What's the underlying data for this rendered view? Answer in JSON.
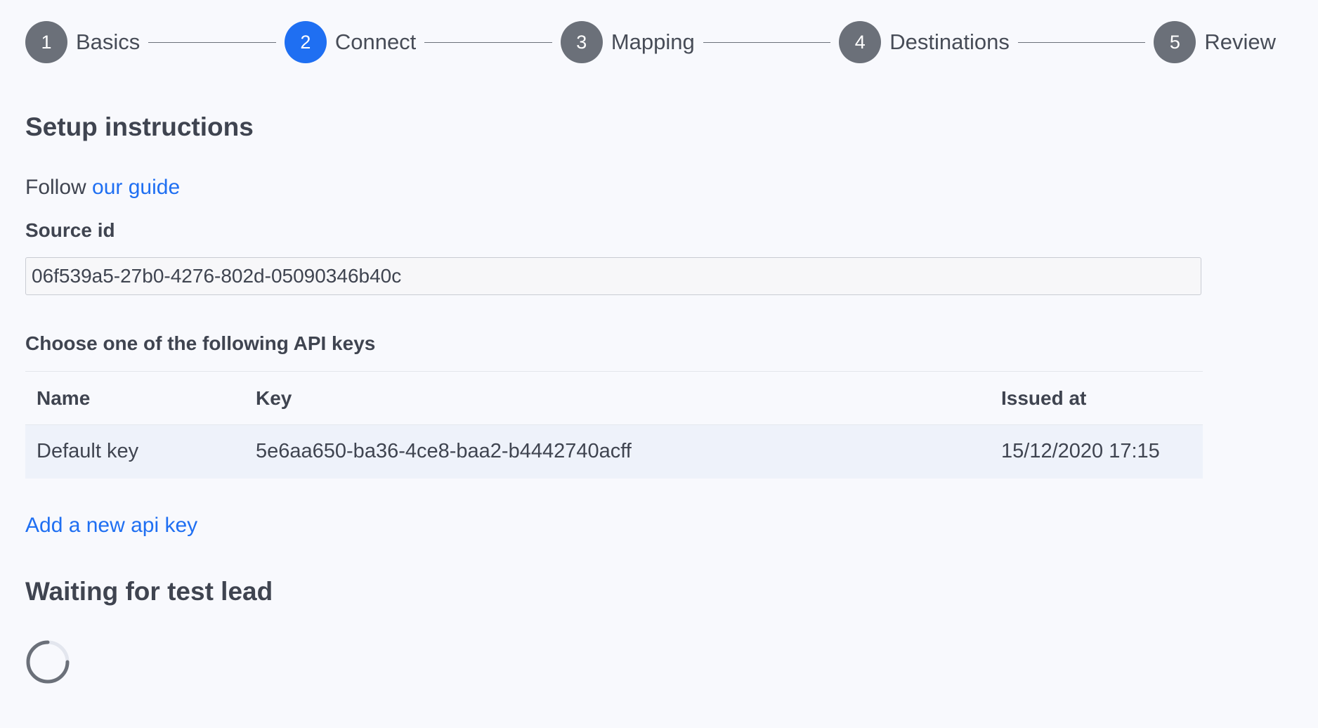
{
  "stepper": {
    "steps": [
      {
        "number": "1",
        "label": "Basics"
      },
      {
        "number": "2",
        "label": "Connect"
      },
      {
        "number": "3",
        "label": "Mapping"
      },
      {
        "number": "4",
        "label": "Destinations"
      },
      {
        "number": "5",
        "label": "Review"
      }
    ],
    "active_step": "2",
    "colors": {
      "active": "#1f6ff2",
      "inactive": "#6b7079"
    }
  },
  "setup": {
    "title": "Setup instructions",
    "follow_prefix": "Follow",
    "guide_link": "our guide",
    "source_id_label": "Source id",
    "source_id_value": "06f539a5-27b0-4276-802d-05090346b40c"
  },
  "api_keys": {
    "heading": "Choose one of the following API keys",
    "columns": {
      "name": "Name",
      "key": "Key",
      "issued": "Issued at"
    },
    "rows": [
      {
        "name": "Default key",
        "key": "5e6aa650-ba36-4ce8-baa2-b4442740acff",
        "issued": "15/12/2020 17:15"
      }
    ],
    "add_link": "Add a new api key"
  },
  "waiting": {
    "title": "Waiting for test lead",
    "spinner_icon": "loading-spinner-icon"
  },
  "theme": {
    "link_color": "#1f6ff2",
    "background": "#f8f9fd"
  }
}
